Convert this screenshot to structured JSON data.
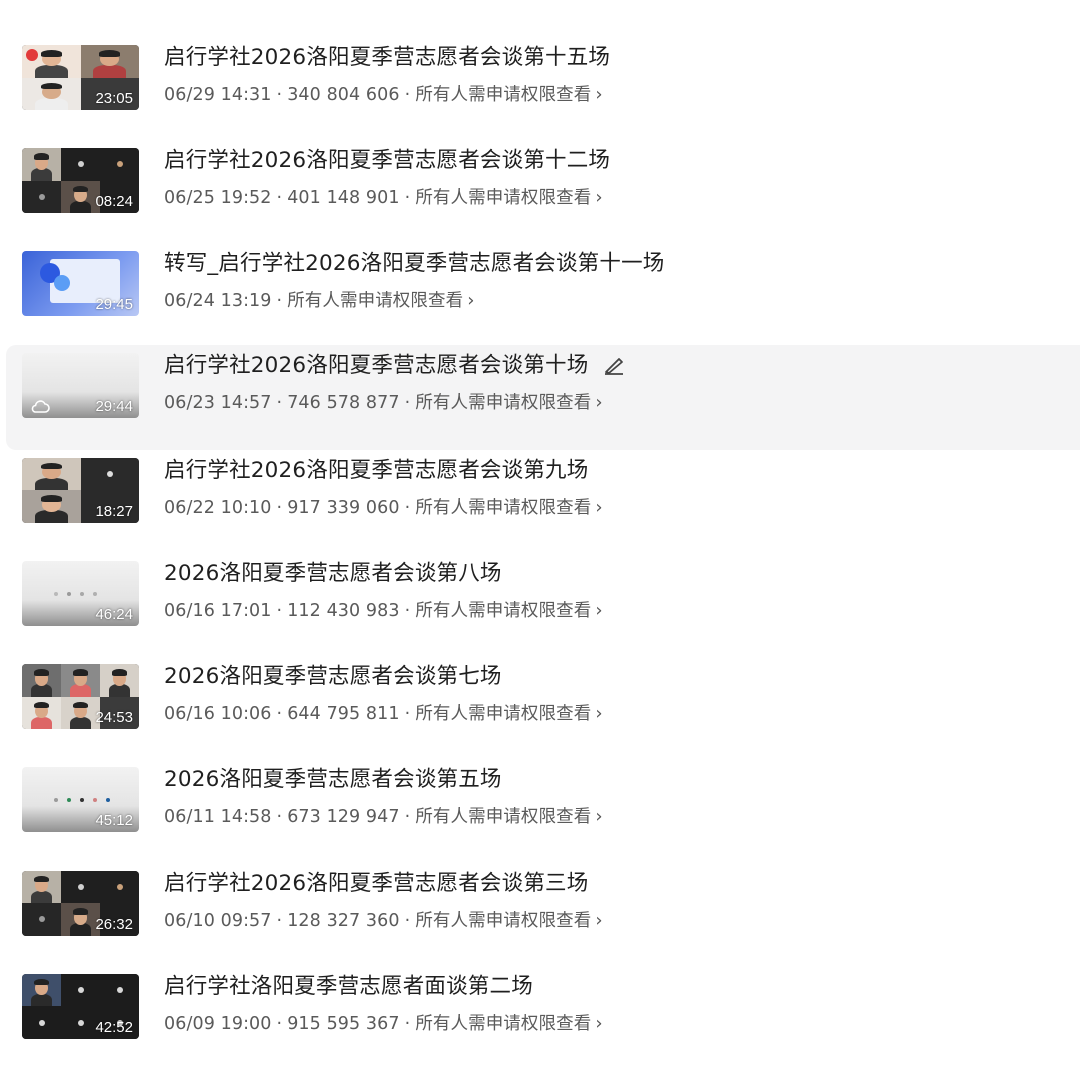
{
  "recordings": [
    {
      "title": "启行学社2026洛阳夏季营志愿者会谈第十五场",
      "date": "06/29 14:31",
      "meeting_id": "340 804 606",
      "permission": "所有人需申请权限查看",
      "duration": "23:05",
      "thumb": "video-two-people-flowers"
    },
    {
      "title": "启行学社2026洛阳夏季营志愿者会谈第十二场",
      "date": "06/25 19:52",
      "meeting_id": "401 148 901",
      "permission": "所有人需申请权限查看",
      "duration": "08:24",
      "thumb": "video-grid-dark"
    },
    {
      "title": "转写_启行学社2026洛阳夏季营志愿者会谈第十一场",
      "date": "06/24 13:19",
      "meeting_id": "",
      "permission": "所有人需申请权限查看",
      "duration": "29:45",
      "thumb": "transcript-blue"
    },
    {
      "title": "启行学社2026洛阳夏季营志愿者会谈第十场",
      "date": "06/23 14:57",
      "meeting_id": "746 578 877",
      "permission": "所有人需申请权限查看",
      "duration": "29:44",
      "thumb": "light-blank",
      "hovered": true
    },
    {
      "title": "启行学社2026洛阳夏季营志愿者会谈第九场",
      "date": "06/22 10:10",
      "meeting_id": "917 339 060",
      "permission": "所有人需申请权限查看",
      "duration": "18:27",
      "thumb": "video-two-people"
    },
    {
      "title": "2026洛阳夏季营志愿者会谈第八场",
      "date": "06/16 17:01",
      "meeting_id": "112 430 983",
      "permission": "所有人需申请权限查看",
      "duration": "46:24",
      "thumb": "light-dots"
    },
    {
      "title": "2026洛阳夏季营志愿者会谈第七场",
      "date": "06/16 10:06",
      "meeting_id": "644 795 811",
      "permission": "所有人需申请权限查看",
      "duration": "24:53",
      "thumb": "video-four-people"
    },
    {
      "title": "2026洛阳夏季营志愿者会谈第五场",
      "date": "06/11 14:58",
      "meeting_id": "673 129 947",
      "permission": "所有人需申请权限查看",
      "duration": "45:12",
      "thumb": "light-colored-dots"
    },
    {
      "title": "启行学社2026洛阳夏季营志愿者会谈第三场",
      "date": "06/10 09:57",
      "meeting_id": "128 327 360",
      "permission": "所有人需申请权限查看",
      "duration": "26:32",
      "thumb": "video-grid-dark"
    },
    {
      "title": "启行学社洛阳夏季营志愿者面谈第二场",
      "date": "06/09 19:00",
      "meeting_id": "915 595 367",
      "permission": "所有人需申请权限查看",
      "duration": "42:52",
      "thumb": "video-grid-dots"
    }
  ],
  "separator": "·",
  "chevron": "›",
  "icons": {
    "edit": "edit-pencil-icon",
    "cloud": "cloud-icon",
    "chevron": "chevron-right-icon"
  },
  "colors": {
    "hover_bg": "#f4f4f5",
    "title": "#1f1f1f",
    "meta": "#5a5a5a"
  }
}
